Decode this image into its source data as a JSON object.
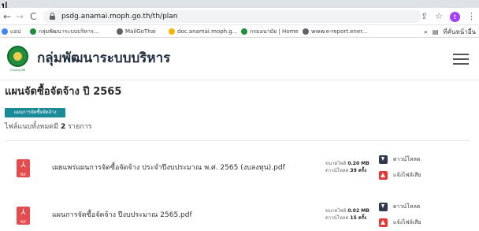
{
  "browser": {
    "url": "psdg.anamai.moph.go.th/th/plan",
    "avatar_letter": "t",
    "nav": {
      "back": "←",
      "forward": "→",
      "reload": "C"
    },
    "bookmarks": [
      {
        "label": "แอป",
        "color": "#4285f4"
      },
      {
        "label": "กลุ่มพัฒนาระบบบริหาร...",
        "color": "#1f8f3e"
      },
      {
        "label": "MailGoThai",
        "color": "#5f6368"
      },
      {
        "label": "doc.anamai.moph.g...",
        "color": "#f4b400"
      },
      {
        "label": "กรมอนามัย | Home",
        "color": "#1f8f3e"
      },
      {
        "label": "www.e-report.ener...",
        "color": "#5f6368"
      }
    ],
    "bookmarks_more": "»",
    "other_bookmarks": "ที่คั่นหน้าอื่น"
  },
  "header": {
    "logo_text": "กรมอนามัย",
    "title": "กลุ่มพัฒนาระบบบริหาร"
  },
  "content": {
    "page_title": "แผนจัดซื้อจัดจ้าง ปี 2565",
    "tag": "แผนการจัดซื้อจัดจ้าง",
    "count_prefix": "ไฟล์แนบทั้งหมดมี",
    "count_value": "2",
    "count_suffix": "รายการ",
    "files": [
      {
        "name": "เผยแพร่แผนการจัดซื้อจัดจ้าง ประจำปีงบประมาณ พ.ศ. 2565 (งบลงทุน).pdf",
        "size_label": "ขนาดไฟล์",
        "size": "0.20 MB",
        "downloads_label": "ดาวน์โหลด",
        "downloads": "39 ครั้ง",
        "download_action": "ดาวน์โหลด",
        "report_action": "แจ้งไฟล์เสีย",
        "icon_label": "PDF"
      },
      {
        "name": "แผนการจัดซื้อจัดจ้าง ปีงบประมาณ 2565.pdf",
        "size_label": "ขนาดไฟล์",
        "size": "0.02 MB",
        "downloads_label": "ดาวน์โหลด",
        "downloads": "15 ครั้ง",
        "download_action": "ดาวน์โหลด",
        "report_action": "แจ้งไฟล์เสีย",
        "icon_label": "PDF"
      }
    ]
  }
}
